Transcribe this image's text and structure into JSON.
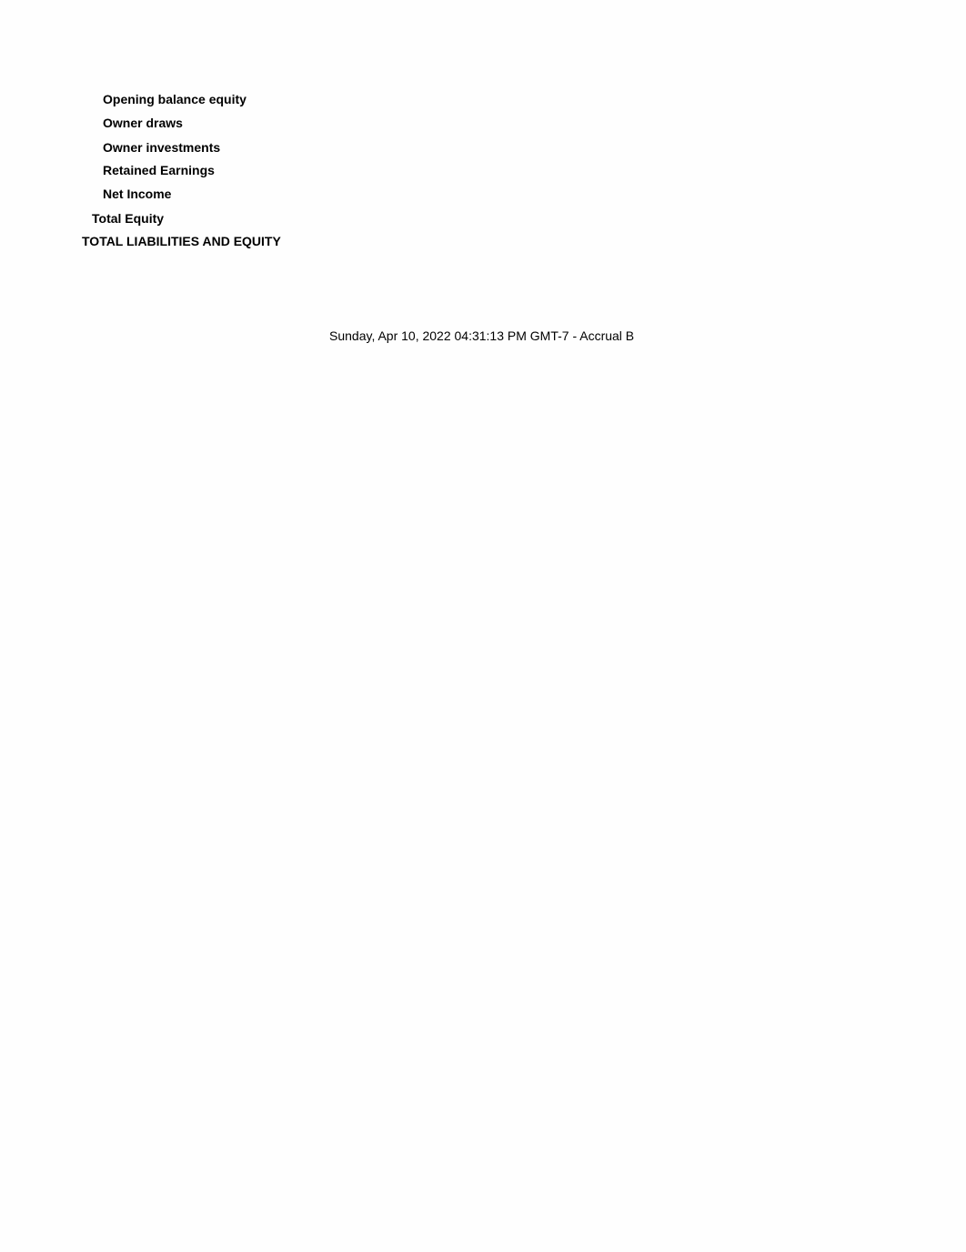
{
  "report": {
    "rows": [
      {
        "label": "Opening balance equity",
        "level": 2
      },
      {
        "label": "Owner draws",
        "level": 2
      },
      {
        "label": "Owner investments",
        "level": 2
      },
      {
        "label": "Retained Earnings",
        "level": 2
      },
      {
        "label": "Net Income",
        "level": 2
      },
      {
        "label": "Total Equity",
        "level": 1
      },
      {
        "label": "TOTAL LIABILITIES AND EQUITY",
        "level": 0
      }
    ],
    "footer": "Sunday, Apr 10, 2022 04:31:13 PM GMT-7 - Accrual B"
  }
}
